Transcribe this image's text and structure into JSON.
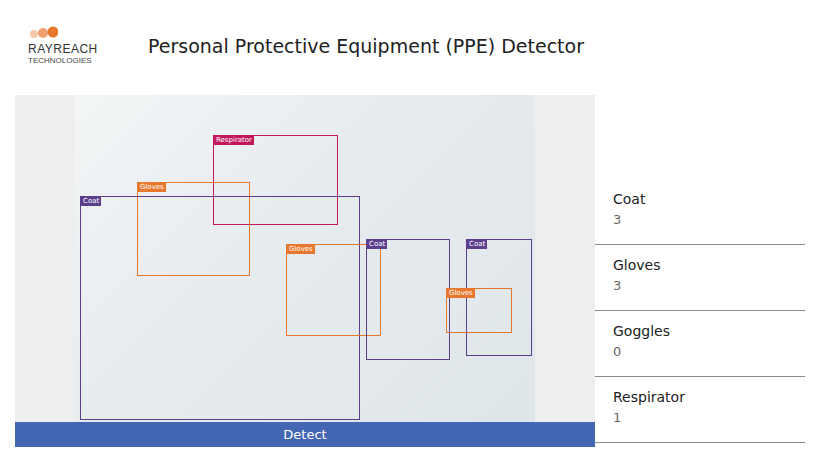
{
  "header": {
    "logo": {
      "name": "RAYREACH",
      "subtitle": "TECHNOLOGIES"
    },
    "title": "Personal Protective Equipment (PPE) Detector"
  },
  "detections": [
    {
      "label": "Respirator",
      "color": "#c2185b"
    },
    {
      "label": "Gloves",
      "color": "#e8772e"
    },
    {
      "label": "Coat",
      "color": "#5b3f8c"
    },
    {
      "label": "Gloves",
      "color": "#e8772e"
    },
    {
      "label": "Coat",
      "color": "#5b3f8c"
    },
    {
      "label": "Coat",
      "color": "#5b3f8c"
    },
    {
      "label": "Gloves",
      "color": "#e8772e"
    }
  ],
  "detect_button": "Detect",
  "counts": [
    {
      "label": "Coat",
      "value": "3"
    },
    {
      "label": "Gloves",
      "value": "3"
    },
    {
      "label": "Goggles",
      "value": "0"
    },
    {
      "label": "Respirator",
      "value": "1"
    }
  ]
}
